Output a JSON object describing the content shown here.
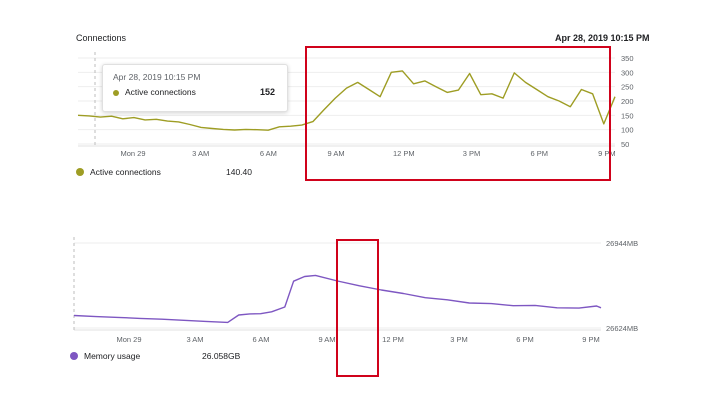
{
  "connections": {
    "title": "Connections",
    "timestamp": "Apr 28, 2019 10:15 PM",
    "tooltip": {
      "date": "Apr 28, 2019 10:15 PM",
      "label": "Active connections",
      "value": "152"
    },
    "legend": {
      "label": "Active connections",
      "value": "140.40",
      "color": "#9e9d24"
    }
  },
  "memory": {
    "legend": {
      "label": "Memory usage",
      "value": "26.058GB",
      "color": "#7e57c2"
    }
  },
  "chart_data": [
    {
      "type": "line",
      "name": "connections",
      "x_ticks": [
        "Mon 29",
        "3 AM",
        "6 AM",
        "9 AM",
        "12 PM",
        "3 PM",
        "6 PM",
        "9 PM"
      ],
      "y_ticks": [
        "350",
        "300",
        "250",
        "200",
        "150",
        "100",
        "50"
      ],
      "ylim": [
        50,
        350
      ],
      "color": "#9e9d24",
      "series": [
        {
          "name": "Active connections",
          "x": [
            0,
            0.5,
            1,
            1.5,
            2,
            2.5,
            3,
            3.5,
            4,
            4.5,
            5,
            5.5,
            6,
            6.5,
            7,
            7.5,
            8,
            8.5,
            9,
            9.5,
            10,
            10.5,
            11,
            11.5,
            12,
            12.5,
            13,
            13.5,
            14,
            14.5,
            15,
            15.5,
            16,
            16.5,
            17,
            17.5,
            18,
            18.5,
            19,
            19.5,
            20,
            20.5,
            21,
            21.5,
            22,
            22.5,
            23,
            23.5,
            24
          ],
          "values": [
            150,
            148,
            144,
            147,
            138,
            142,
            134,
            136,
            130,
            127,
            118,
            108,
            104,
            101,
            99,
            101,
            100,
            98,
            110,
            112,
            116,
            128,
            170,
            210,
            245,
            265,
            240,
            215,
            300,
            305,
            260,
            270,
            250,
            230,
            238,
            296,
            222,
            225,
            210,
            298,
            265,
            240,
            215,
            200,
            180,
            240,
            225,
            120,
            215
          ]
        }
      ]
    },
    {
      "type": "line",
      "name": "memory",
      "x_ticks": [
        "Mon 29",
        "3 AM",
        "6 AM",
        "9 AM",
        "12 PM",
        "3 PM",
        "6 PM",
        "9 PM"
      ],
      "y_ticks": [
        "26944MB",
        "26624MB"
      ],
      "ylim": [
        26624,
        26944
      ],
      "color": "#7e57c2",
      "series": [
        {
          "name": "Memory usage",
          "x": [
            0,
            1,
            2,
            3,
            4,
            5,
            6,
            7,
            7.5,
            8,
            8.5,
            9,
            9.6,
            10,
            10.5,
            11,
            12,
            13,
            14,
            15,
            16,
            17,
            18,
            19,
            20,
            21,
            22,
            23,
            23.8,
            24
          ],
          "values": [
            26671,
            26667,
            26664,
            26660,
            26657,
            26653,
            26649,
            26645,
            26673,
            26677,
            26678,
            26685,
            26703,
            26800,
            26818,
            26822,
            26801,
            26783,
            26767,
            26754,
            26738,
            26730,
            26718,
            26716,
            26708,
            26709,
            26700,
            26699,
            26707,
            26700
          ]
        }
      ]
    }
  ]
}
